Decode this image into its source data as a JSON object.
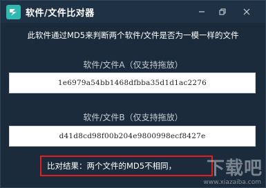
{
  "window": {
    "title": "软件/文件比对器"
  },
  "description": "此软件通过MD5来判断两个软件/文件是否为一模一样的文件",
  "file_a": {
    "label": "软件/文件A（仅支持拖放）",
    "hash": "1e6979a54bb1468dfbba35d1d1ac2276"
  },
  "file_b": {
    "label": "软件/文件B（仅支持拖放）",
    "hash": "d41d8cd98f00b204e9800998ecf8427e"
  },
  "result": {
    "text": "比对结果：两个文件的MD5不相同，"
  },
  "watermark": {
    "text": "下载吧",
    "sub": "www.xiazaiba.com"
  },
  "icons": {
    "app": "app-logo-icon",
    "minimize": "minimize-icon",
    "maximize": "restore-icon",
    "close": "close-icon"
  },
  "colors": {
    "background": "#1b2b3b",
    "titlebar": "#1f3245",
    "accent": "#2fb9b0",
    "result_border": "#e01f1f"
  }
}
